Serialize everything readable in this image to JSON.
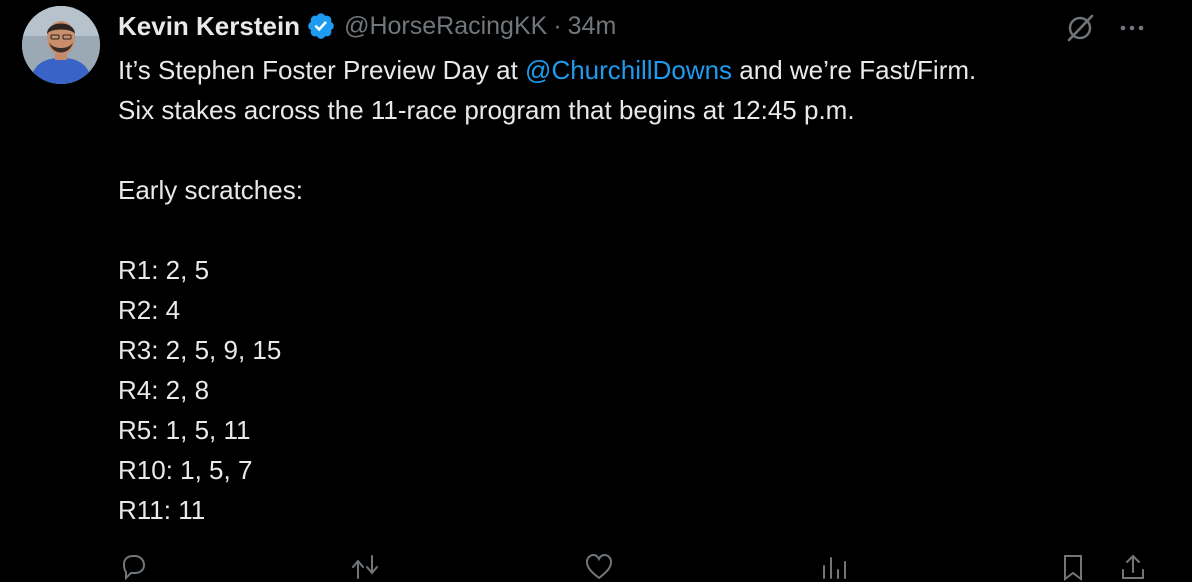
{
  "tweet": {
    "author_name": "Kevin Kerstein",
    "handle": "@HorseRacingKK",
    "separator": "·",
    "time": "34m",
    "line1_pre": "It’s Stephen Foster Preview Day at ",
    "mention": "@ChurchillDowns",
    "line1_post": " and we’re Fast/Firm.",
    "line2": "Six stakes across the 11-race program that begins at 12:45 p.m.",
    "line3": "Early scratches:",
    "scratches": [
      "R1: 2, 5",
      "R2: 4",
      "R3: 2, 5, 9, 15",
      "R4: 2, 8",
      "R5: 1, 5, 11",
      "R10: 1, 5, 7",
      "R11: 11"
    ]
  },
  "icons": {
    "verified": "verified-badge-icon",
    "grok": "grok-icon",
    "more": "more-icon",
    "reply": "reply-icon",
    "retweet": "retweet-icon",
    "like": "like-icon",
    "views": "views-icon",
    "bookmark": "bookmark-icon",
    "share": "share-icon"
  },
  "colors": {
    "background": "#000000",
    "text": "#e7e9ea",
    "secondary": "#71767b",
    "accent": "#1d9bf0"
  }
}
